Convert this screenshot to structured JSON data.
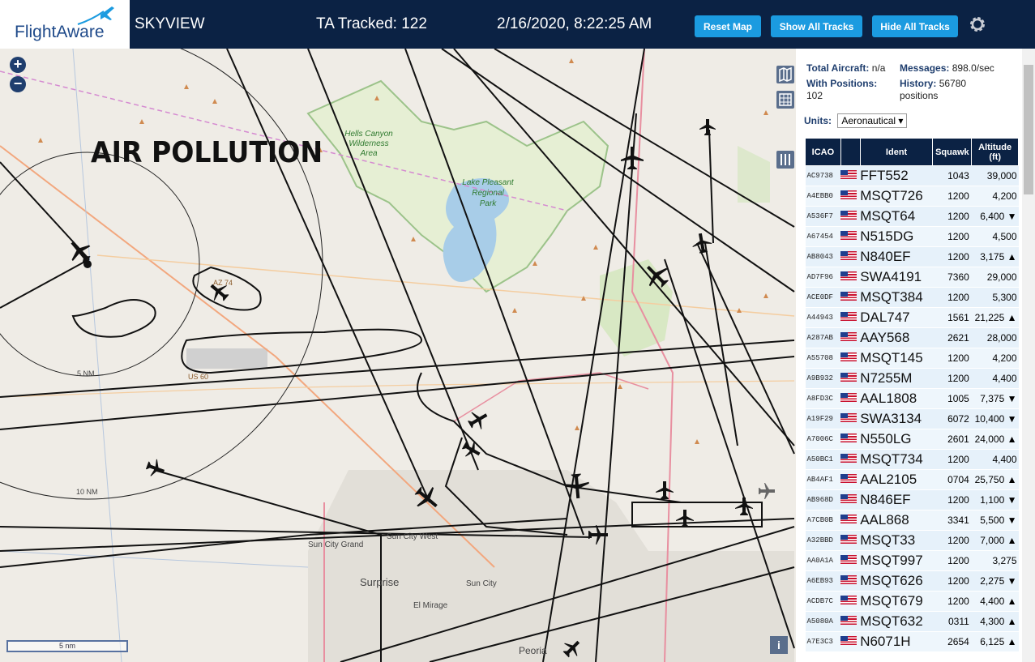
{
  "header": {
    "brand_flight": "Flight",
    "brand_aware": "Aware",
    "app_name": "SKYVIEW",
    "ta_tracked": "TA Tracked: 122",
    "datetime": "2/16/2020, 8:22:25 AM",
    "buttons": {
      "reset": "Reset Map",
      "show_all": "Show All Tracks",
      "hide_all": "Hide All Tracks"
    },
    "settings_icon": "gear-icon"
  },
  "map": {
    "zoom_in": "+",
    "zoom_out": "−",
    "overlay_title": "AIR POLLUTION",
    "scale_label": "5 nm",
    "info_label": "i",
    "labels": {
      "hells_canyon": [
        "Hells Canyon",
        "Wilderness",
        "Area"
      ],
      "lake_pleasant": [
        "Lake Pleasant",
        "Regional",
        "Park"
      ],
      "sun_city_grand": "Sun City Grand",
      "sun_city_west": "Sun City West",
      "sun_city": "Sun City",
      "surprise": "Surprise",
      "el_mirage": "El Mirage",
      "peoria": "Peoria",
      "ring_5nm": "5 NM",
      "ring_10nm": "10 NM",
      "route_az74": "AZ 74",
      "route_us60": "US 60"
    }
  },
  "sidebar": {
    "stats": {
      "total_label": "Total Aircraft:",
      "total_value": "n/a",
      "messages_label": "Messages:",
      "messages_value": "898.0/sec",
      "positions_label": "With Positions:",
      "positions_value": "102",
      "history_label": "History:",
      "history_value": "56780",
      "history_unit": "positions"
    },
    "units_label": "Units:",
    "units_value": "Aeronautical",
    "columns": {
      "icao": "ICAO",
      "ident": "Ident",
      "squawk": "Squawk",
      "altitude": "Altitude",
      "altitude_unit": "(ft)"
    },
    "rows": [
      {
        "icao": "AC9738",
        "ident": "FFT552",
        "squawk": "1043",
        "alt": "39,000"
      },
      {
        "icao": "A4EBB0",
        "ident": "MSQT726",
        "squawk": "1200",
        "alt": "4,200"
      },
      {
        "icao": "A536F7",
        "ident": "MSQT64",
        "squawk": "1200",
        "alt": "6,400 ▼"
      },
      {
        "icao": "A67454",
        "ident": "N515DG",
        "squawk": "1200",
        "alt": "4,500"
      },
      {
        "icao": "AB8043",
        "ident": "N840EF",
        "squawk": "1200",
        "alt": "3,175 ▲"
      },
      {
        "icao": "AD7F96",
        "ident": "SWA4191",
        "squawk": "7360",
        "alt": "29,000"
      },
      {
        "icao": "ACE0DF",
        "ident": "MSQT384",
        "squawk": "1200",
        "alt": "5,300"
      },
      {
        "icao": "A44943",
        "ident": "DAL747",
        "squawk": "1561",
        "alt": "21,225 ▲"
      },
      {
        "icao": "A287AB",
        "ident": "AAY568",
        "squawk": "2621",
        "alt": "28,000"
      },
      {
        "icao": "A55708",
        "ident": "MSQT145",
        "squawk": "1200",
        "alt": "4,200"
      },
      {
        "icao": "A9B932",
        "ident": "N7255M",
        "squawk": "1200",
        "alt": "4,400"
      },
      {
        "icao": "A8FD3C",
        "ident": "AAL1808",
        "squawk": "1005",
        "alt": "7,375 ▼"
      },
      {
        "icao": "A19F29",
        "ident": "SWA3134",
        "squawk": "6072",
        "alt": "10,400 ▼"
      },
      {
        "icao": "A7006C",
        "ident": "N550LG",
        "squawk": "2601",
        "alt": "24,000 ▲"
      },
      {
        "icao": "A50BC1",
        "ident": "MSQT734",
        "squawk": "1200",
        "alt": "4,400"
      },
      {
        "icao": "AB4AF1",
        "ident": "AAL2105",
        "squawk": "0704",
        "alt": "25,750 ▲"
      },
      {
        "icao": "AB968D",
        "ident": "N846EF",
        "squawk": "1200",
        "alt": "1,100 ▼"
      },
      {
        "icao": "A7CB0B",
        "ident": "AAL868",
        "squawk": "3341",
        "alt": "5,500 ▼"
      },
      {
        "icao": "A32BBD",
        "ident": "MSQT33",
        "squawk": "1200",
        "alt": "7,000 ▲"
      },
      {
        "icao": "AA0A1A",
        "ident": "MSQT997",
        "squawk": "1200",
        "alt": "3,275"
      },
      {
        "icao": "A6EB93",
        "ident": "MSQT626",
        "squawk": "1200",
        "alt": "2,275 ▼"
      },
      {
        "icao": "ACDB7C",
        "ident": "MSQT679",
        "squawk": "1200",
        "alt": "4,400 ▲"
      },
      {
        "icao": "A5080A",
        "ident": "MSQT632",
        "squawk": "0311",
        "alt": "4,300 ▲"
      },
      {
        "icao": "A7E3C3",
        "ident": "N6071H",
        "squawk": "2654",
        "alt": "6,125 ▲"
      }
    ]
  }
}
